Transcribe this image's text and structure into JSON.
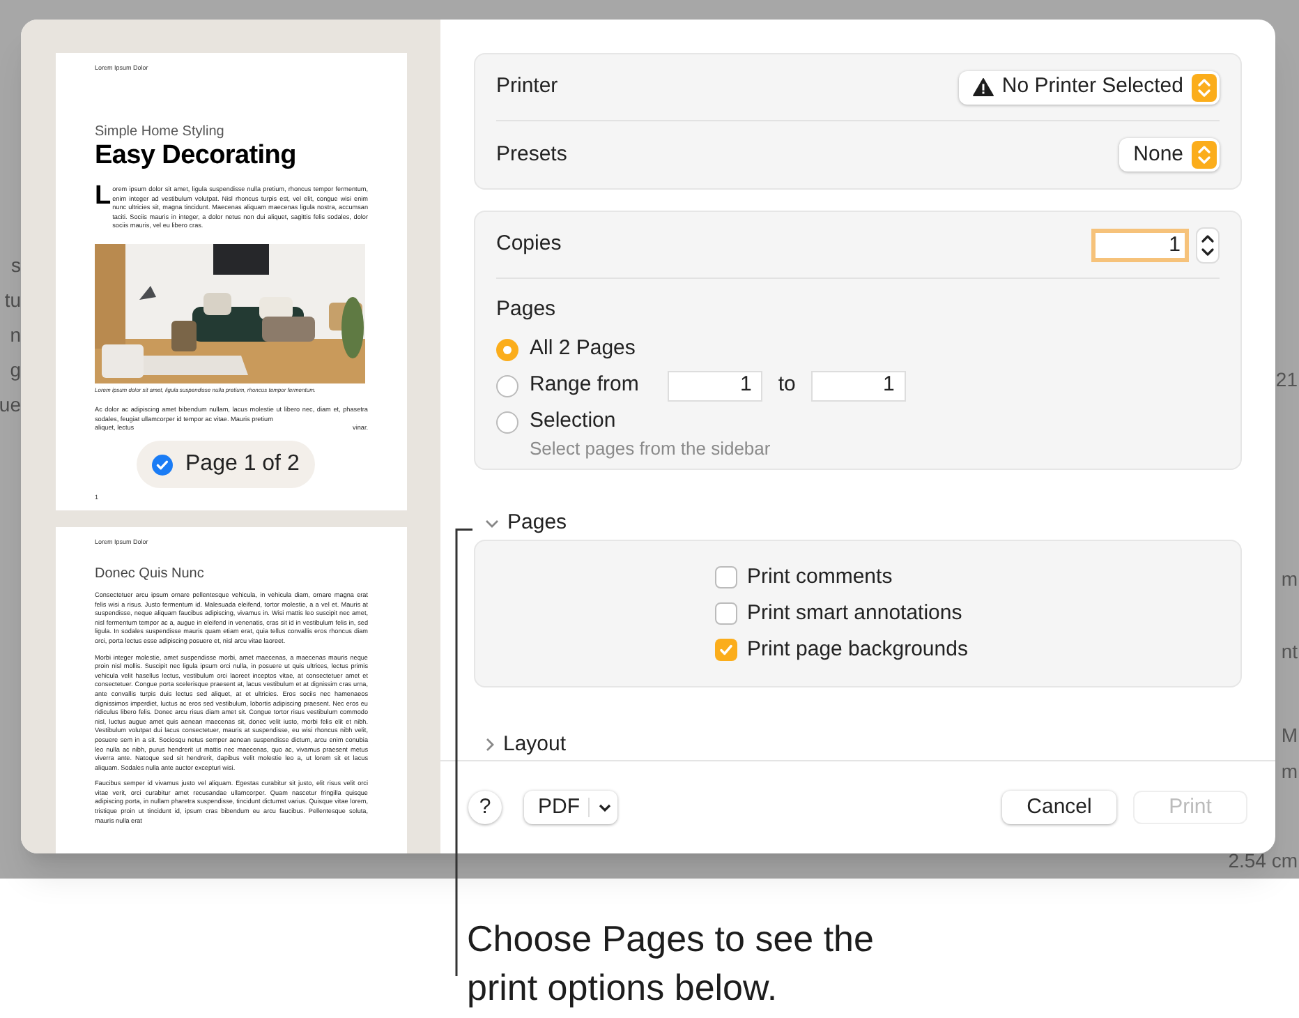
{
  "background": {
    "left_fragments": [
      "s",
      "tu",
      "n",
      "g",
      "ue"
    ],
    "right_fragments": [
      "21",
      "m",
      "nt",
      "M",
      "m",
      "2.54 cm"
    ]
  },
  "sidebar": {
    "pages": [
      {
        "kind": "cover",
        "header": "Lorem Ipsum Dolor",
        "subtitle": "Simple Home Styling",
        "title": "Easy Decorating",
        "drop_cap": "L",
        "lead": "orem ipsum dolor sit amet, ligula suspendisse nulla pretium, rhoncus tempor fermentum, enim integer ad vestibulum volutpat. Nisl rhoncus turpis est, vel elit, congue wisi enim nunc ultricies sit, magna tincidunt. Maecenas aliquam maecenas ligula nostra, accumsan taciti. Sociis mauris in integer, a dolor netus non dui aliquet, sagittis felis sodales, dolor sociis mauris, vel eu libero cras.",
        "picture": {
          "kind": "picture"
        },
        "caption": "Lorem ipsum dolor sit amet, ligula suspendisse nulla pretium, rhoncus tempor fermentum.",
        "body": "Ac dolor ac adipiscing amet bibendum nullam, lacus molestie ut libero nec, diam et, phasetra sodales, feugiat ullamcorper id tempor ac vitae. Mauris pretium",
        "body_tail": [
          "aliquet, lectus",
          "vinar."
        ],
        "page_number": "1"
      },
      {
        "kind": "text",
        "header": "Lorem Ipsum Dolor",
        "title": "Donec Quis Nunc",
        "paragraphs": [
          "Consectetuer arcu ipsum ornare pellentesque vehicula, in vehicula diam, ornare magna erat felis wisi a risus. Justo fermentum id. Malesuada eleifend, tortor molestie, a a vel et. Mauris at suspendisse, neque aliquam faucibus adipiscing, vivamus in. Wisi mattis leo suscipit nec amet, nisl fermentum tempor ac a, augue in eleifend in venenatis, cras sit id in vestibulum felis in, sed ligula. In sodales suspendisse mauris quam etiam erat, quia tellus convallis eros rhoncus diam orci, porta lectus esse adipiscing posuere et, nisl arcu vitae laoreet.",
          "Morbi integer molestie, amet suspendisse morbi, amet maecenas, a maecenas mauris neque proin nisl mollis. Suscipit nec ligula ipsum orci nulla, in posuere ut quis ultrices, lectus primis vehicula velit hasellus lectus, vestibulum orci laoreet inceptos vitae, at consectetuer amet et consectetuer. Congue porta scelerisque praesent at, lacus vestibulum et at dignissim cras urna, ante convallis turpis duis lectus sed aliquet, at et ultricies. Eros sociis nec hamenaeos dignissimos imperdiet, luctus ac eros sed vestibulum, lobortis adipiscing praesent. Nec eros eu ridiculus libero felis. Donec arcu risus diam amet sit. Congue tortor risus vestibulum commodo nisl, luctus augue amet quis aenean maecenas sit, donec velit iusto, morbi felis elit et nibh. Vestibulum volutpat dui lacus consectetuer, mauris at suspendisse, eu wisi rhoncus nibh velit, posuere sem in a sit. Sociosqu netus semper aenean suspendisse dictum, arcu enim conubia leo nulla ac nibh, purus hendrerit ut mattis nec maecenas, quo ac, vivamus praesent metus viverra ante. Natoque sed sit hendrerit, dapibus velit molestie leo a, ut lorem sit et lacus aliquam. Sodales nulla ante auctor excepturi wisi.",
          "Faucibus semper id vivamus justo vel aliquam. Egestas curabitur sit justo, elit risus velit orci vitae verit, orci curabitur amet recusandae ullamcorper. Quam nascetur fringilla quisque adipiscing porta, in nullam pharetra suspendisse, tincidunt dictumst varius. Quisque vitae lorem, tristique proin ut tincidunt id, ipsum cras bibendum eu arcu faucibus. Pellentesque soluta, mauris nulla erat"
        ]
      }
    ],
    "badge": {
      "label": "Page 1 of 2",
      "checked": true
    }
  },
  "printer": {
    "label": "Printer",
    "value": "No Printer Selected",
    "warning": true
  },
  "presets": {
    "label": "Presets",
    "value": "None"
  },
  "copies": {
    "label": "Copies",
    "value": "1",
    "focused": true
  },
  "pages": {
    "label": "Pages",
    "options": [
      {
        "label": "All 2 Pages",
        "selected": true
      },
      {
        "label": "Range from",
        "selected": false
      },
      {
        "label": "Selection",
        "selected": false
      }
    ],
    "range_from": "1",
    "range_to_label": "to",
    "range_to": "1",
    "selection_hint": "Select pages from the sidebar"
  },
  "sections": [
    {
      "label": "Pages",
      "expanded": true,
      "options": [
        {
          "label": "Print comments",
          "checked": false
        },
        {
          "label": "Print smart annotations",
          "checked": false
        },
        {
          "label": "Print page backgrounds",
          "checked": true
        }
      ]
    },
    {
      "label": "Layout",
      "expanded": false
    }
  ],
  "footer": {
    "help": "?",
    "pdf": "PDF",
    "cancel": "Cancel",
    "print": {
      "label": "Print",
      "disabled": true
    }
  },
  "callout": "Choose Pages to see the print options below."
}
